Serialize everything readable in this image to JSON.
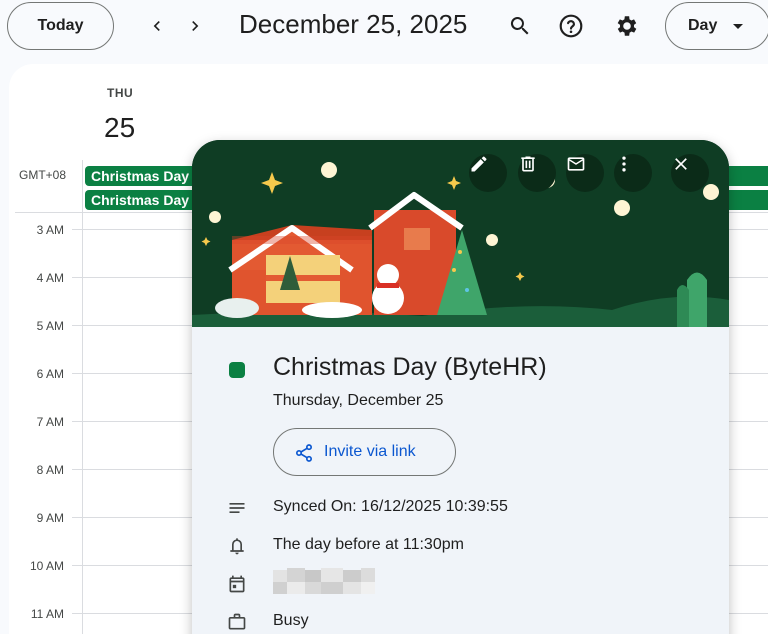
{
  "toolbar": {
    "today_label": "Today",
    "date_title": "December 25, 2025",
    "view_label": "Day"
  },
  "icons": {
    "prev": "chevron-left-icon",
    "next": "chevron-right-icon",
    "search": "search-icon",
    "help": "help-icon",
    "settings": "gear-icon"
  },
  "day_header": {
    "weekday": "THU",
    "day_number": "25"
  },
  "timezone_label": "GMT+08",
  "all_day_events": [
    {
      "title": "Christmas Day",
      "color": "#0b8043"
    },
    {
      "title": "Christmas Day",
      "color": "#0b8043"
    }
  ],
  "hours": [
    "3 AM",
    "4 AM",
    "5 AM",
    "6 AM",
    "7 AM",
    "8 AM",
    "9 AM",
    "10 AM",
    "11 AM"
  ],
  "popup": {
    "actions": [
      "edit-icon",
      "delete-icon",
      "email-icon",
      "more-options-icon",
      "close-icon"
    ],
    "event_color": "#0b8043",
    "title": "Christmas Day (ByteHR)",
    "date": "Thursday, December 25",
    "invite_label": "Invite via link",
    "description": "Synced On: 16/12/2025 10:39:55",
    "reminder": "The day before at 11:30pm",
    "availability": "Busy"
  },
  "colors": {
    "accent": "#0b57d0",
    "event_green": "#0b8043",
    "banner_bg": "#0f3d24"
  }
}
